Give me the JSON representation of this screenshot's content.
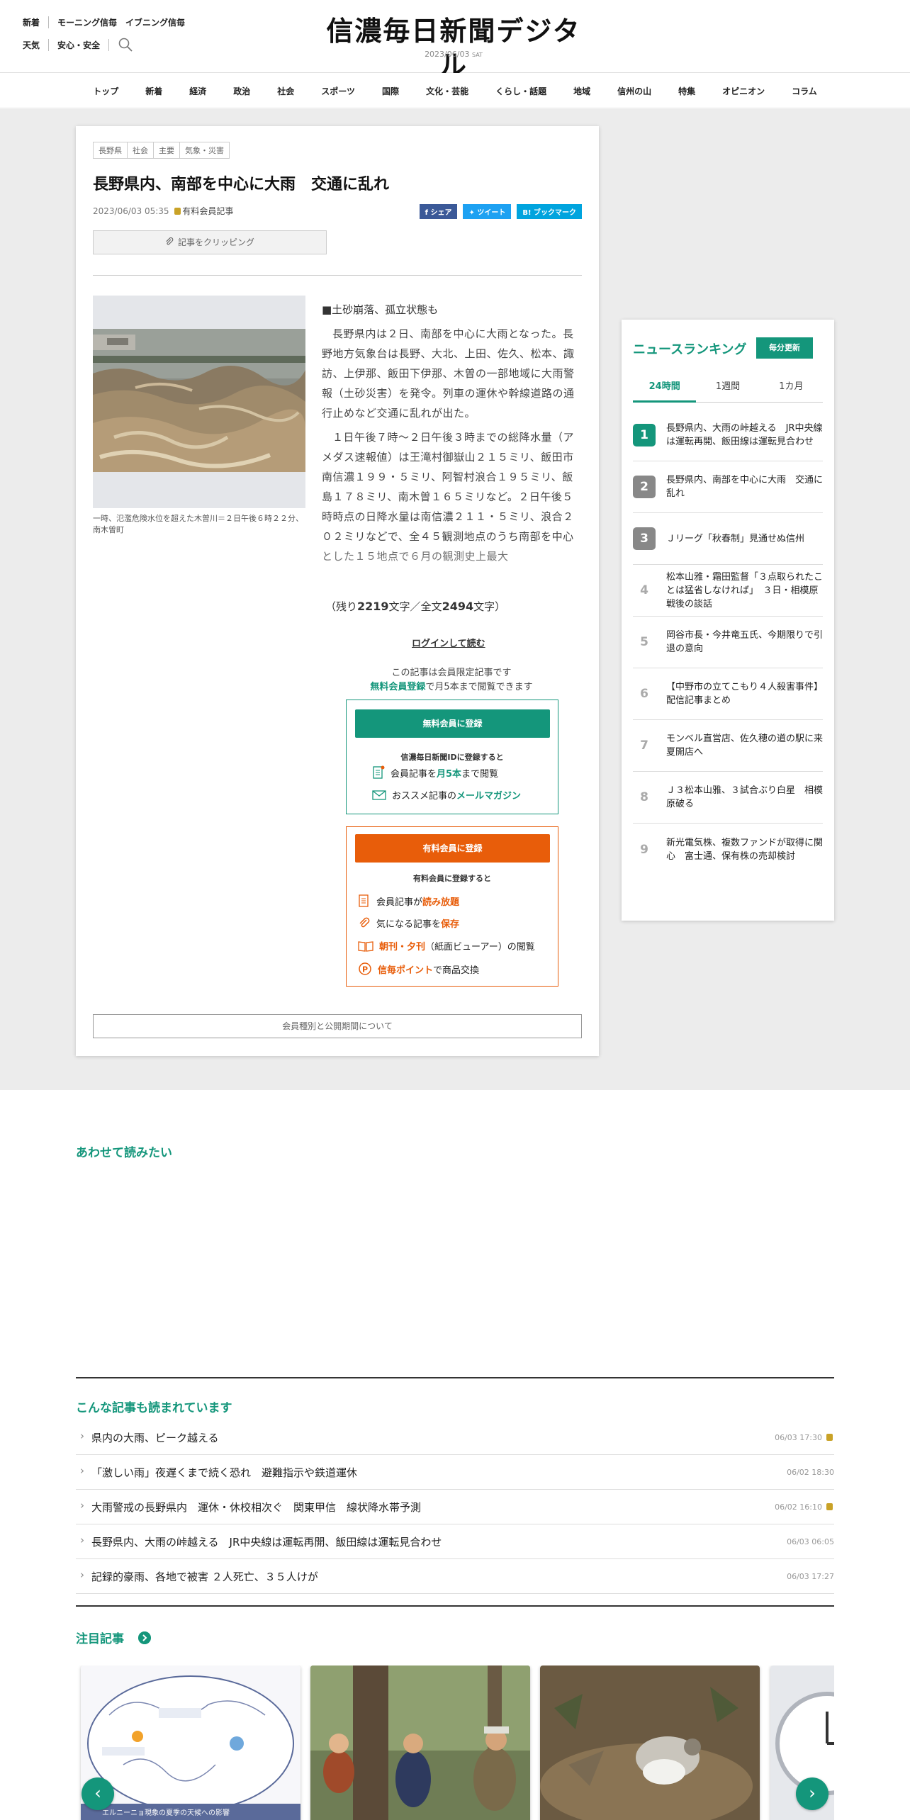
{
  "header": {
    "links_row1": [
      "新着",
      "モーニング信毎",
      "イブニング信毎"
    ],
    "links_row2": [
      "天気",
      "安心・安全"
    ],
    "logo": "信濃毎日新聞デジタル",
    "date": "2023/06/03",
    "weekday": "SAT"
  },
  "nav": [
    "トップ",
    "新着",
    "経済",
    "政治",
    "社会",
    "スポーツ",
    "国際",
    "文化・芸能",
    "くらし・話題",
    "地域",
    "信州の山",
    "特集",
    "オピニオン",
    "コラム"
  ],
  "article": {
    "tags": [
      "長野県",
      "社会",
      "主要",
      "気象・災害"
    ],
    "title": "長野県内、南部を中心に大雨　交通に乱れ",
    "datetime": "2023/06/03 05:35",
    "member_label": "有料会員記事",
    "share": [
      "シェア",
      "ツイート",
      "ブックマーク"
    ],
    "clip_label": "記事をクリッピング",
    "photo_caption": "一時、氾濫危険水位を超えた木曽川＝２日午後６時２２分、南木曽町",
    "lead": "■土砂崩落、孤立状態も",
    "para1": "長野県内は２日、南部を中心に大雨となった。長野地方気象台は長野、大北、上田、佐久、松本、諏訪、上伊那、飯田下伊那、木曽の一部地域に大雨警報（土砂災害）を発令。列車の運休や幹線道路の通行止めなど交通に乱れが出た。",
    "para2": "１日午後７時～２日午後３時までの総降水量（アメダス速報値）は王滝村御嶽山２１５ミリ、飯田市南信濃１９９・５ミリ、阿智村浪合１９５ミリ、飯島１７８ミリ、南木曽１６５ミリなど。２日午後５時時点の日降水量は南信濃２１１・５ミリ、浪合２０２ミリなどで、全４５観測地点のうち南部を中心とした１５地点で６月の観測史上最大",
    "remain_prefix": "（残り",
    "remain_chars": "2219",
    "remain_mid": "文字／全文",
    "total_chars": "2494",
    "remain_suffix": "文字）",
    "login": "ログインして読む",
    "limited_note": "この記事は会員限定記事です",
    "free_reg_link": "無料会員登録",
    "free_reg_suffix": "で月5本まで閲覧できます",
    "free_btn": "無料会員に登録",
    "free_sub": "信濃毎日新聞IDに登録すると",
    "free_feat1_a": "会員記事を",
    "free_feat1_b": "月5本",
    "free_feat1_c": "まで閲覧",
    "free_feat2_a": "おススメ記事の",
    "free_feat2_b": "メールマガジン",
    "paid_btn": "有料会員に登録",
    "paid_sub": "有料会員に登録すると",
    "paid_feat1_a": "会員記事が",
    "paid_feat1_b": "読み放題",
    "paid_feat2_a": "気になる記事を",
    "paid_feat2_b": "保存",
    "paid_feat3_a": "朝刊・夕刊",
    "paid_feat3_b": "（紙面ビューアー）の閲覧",
    "paid_feat4_a": "信毎ポイント",
    "paid_feat4_b": "で商品交換",
    "kind_btn": "会員種別と公開期間について"
  },
  "ranking": {
    "title": "ニュースランキング",
    "update": "毎分更新",
    "tabs": [
      "24時間",
      "1週間",
      "1カ月"
    ],
    "items": [
      {
        "rank": "1",
        "text": "長野県内、大雨の峠越える　JR中央線は運転再開、飯田線は運転見合わせ"
      },
      {
        "rank": "2",
        "text": "長野県内、南部を中心に大雨　交通に乱れ"
      },
      {
        "rank": "3",
        "text": "Ｊリーグ「秋春制」見通せぬ信州"
      },
      {
        "rank": "4",
        "text": "松本山雅・霜田監督「３点取られたことは猛省しなければ」　３日・相模原戦後の談話"
      },
      {
        "rank": "5",
        "text": "岡谷市長・今井竜五氏、今期限りで引退の意向"
      },
      {
        "rank": "6",
        "text": "【中野市の立てこもり４人殺害事件】配信記事まとめ"
      },
      {
        "rank": "7",
        "text": "モンベル直営店、佐久穂の道の駅に来夏開店へ"
      },
      {
        "rank": "8",
        "text": "Ｊ３松本山雅、３試合ぶり白星　相模原破る"
      },
      {
        "rank": "9",
        "text": "新光電気株、複数ファンドが取得に関心　富士通、保有株の売却検討"
      }
    ]
  },
  "related": {
    "heading": "あわせて読みたい"
  },
  "also_read": {
    "heading": "こんな記事も読まれています",
    "items": [
      {
        "title": "県内の大雨、ピーク越える",
        "date": "06/03 17:30",
        "locked": true
      },
      {
        "title": "「激しい雨」夜遅くまで続く恐れ　避難指示や鉄道運休",
        "date": "06/02 18:30",
        "locked": false
      },
      {
        "title": "大雨警戒の長野県内　運休・休校相次ぐ　関東甲信　線状降水帯予測",
        "date": "06/02 16:10",
        "locked": true
      },
      {
        "title": "長野県内、大雨の峠越える　JR中央線は運転再開、飯田線は運転見合わせ",
        "date": "06/03 06:05",
        "locked": false
      },
      {
        "title": "記録的豪雨、各地で被害 ２人死亡、３５人けが",
        "date": "06/03 17:27",
        "locked": false
      }
    ]
  },
  "featured": {
    "heading": "注目記事",
    "card1_caption": "エルニーニョ現象の夏季の天候への影響"
  },
  "colors": {
    "accent": "#14967b",
    "paid": "#e85d0a",
    "facebook": "#3b5998",
    "twitter": "#1da1f2",
    "hatena": "#00a4de"
  }
}
